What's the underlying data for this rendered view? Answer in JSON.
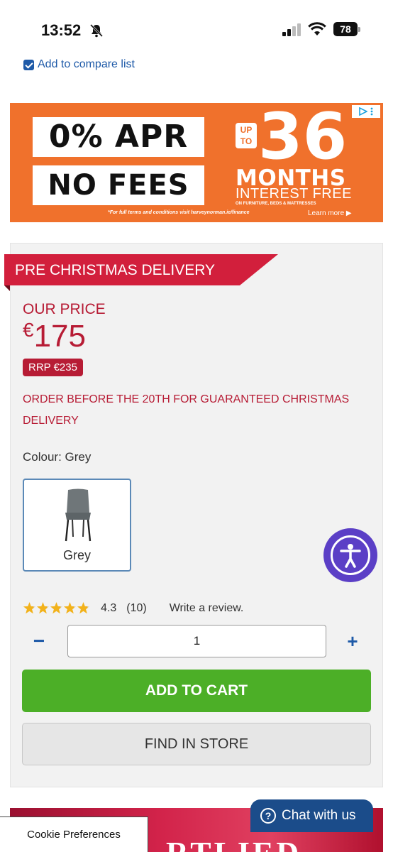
{
  "status_bar": {
    "time": "13:52",
    "battery": "78"
  },
  "compare": {
    "label": "Add to compare list"
  },
  "ad": {
    "line1": "0% APR",
    "line2": "NO FEES",
    "up_to": "UP TO",
    "months_number": "36",
    "months": "MONTHS",
    "interest": "INTEREST FREE",
    "small": "ON FURNITURE, BEDS & MATTRESSES",
    "terms": "*For full terms and conditions visit harveynorman.ie/finance",
    "learn_more": "Learn more ▶"
  },
  "product": {
    "ribbon": "PRE CHRISTMAS DELIVERY",
    "price_label": "OUR PRICE",
    "currency": "€",
    "price": "175",
    "rrp": "RRP €235",
    "delivery_note": "ORDER BEFORE THE 20TH FOR GUARANTEED CHRISTMAS DELIVERY",
    "colour_label": "Colour: Grey",
    "swatch_label": "Grey",
    "rating_value": "4.3",
    "rating_fraction": 0.86,
    "rating_count": "(10)",
    "write_review": "Write a review.",
    "quantity": "1",
    "add_to_cart": "ADD TO CART",
    "find_in_store": "FIND IN STORE"
  },
  "bottom": {
    "promo_text": "RTLIED",
    "cookie": "Cookie Preferences",
    "chat": "Chat with us"
  },
  "colors": {
    "accent_red": "#b71c35",
    "ribbon_red": "#d21f3c",
    "cart_green": "#4caf27",
    "link_blue": "#1e5aa8",
    "ad_orange": "#f0712c",
    "accessibility_purple": "#5b3fc6"
  }
}
